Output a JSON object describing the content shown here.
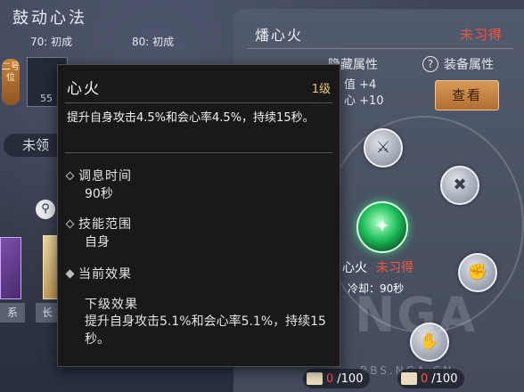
{
  "left_panel": {
    "title": "鼓动心法",
    "realm_a": "70: 初成",
    "realm_b": "80: 初成",
    "vert_tag": "二号位",
    "slot_value": "55",
    "learn_label": "未领",
    "search_icon": "search-icon",
    "bottom_tab1": "系",
    "bottom_tab2": "长"
  },
  "right_panel": {
    "title": "燔心火",
    "status": "未习得",
    "hidden_attr_label": "隐藏属性",
    "equip_attr_label": "装备属性",
    "stat1": "值 +4",
    "stat2": "心 +10",
    "view_button": "查看",
    "center_skill_name": "心火",
    "center_skill_status": "未习得",
    "center_skill_cd": "冷却：90秒",
    "watermark": "NGA",
    "watermark_url": "BBS.NGA.CN",
    "counter1_current": "0",
    "counter1_max": "/100",
    "counter2_current": "0",
    "counter2_max": "/100"
  },
  "tooltip": {
    "name": "心火",
    "level": "1级",
    "description": "提升自身攻击4.5%和会心率4.5%，持续15秒。",
    "cooldown_key": "调息时间",
    "cooldown_value": "90秒",
    "range_key": "技能范围",
    "range_value": "自身",
    "current_effect_key": "当前效果",
    "next_effect_title": "下级效果",
    "next_effect_desc": "提升自身攻击5.1%和会心率5.1%，持续15秒。"
  },
  "colors": {
    "status_red": "#ff4f3e",
    "level_gold": "#e8c773",
    "button_orange": "#d99a58",
    "skill_green": "#1fbf5a"
  }
}
